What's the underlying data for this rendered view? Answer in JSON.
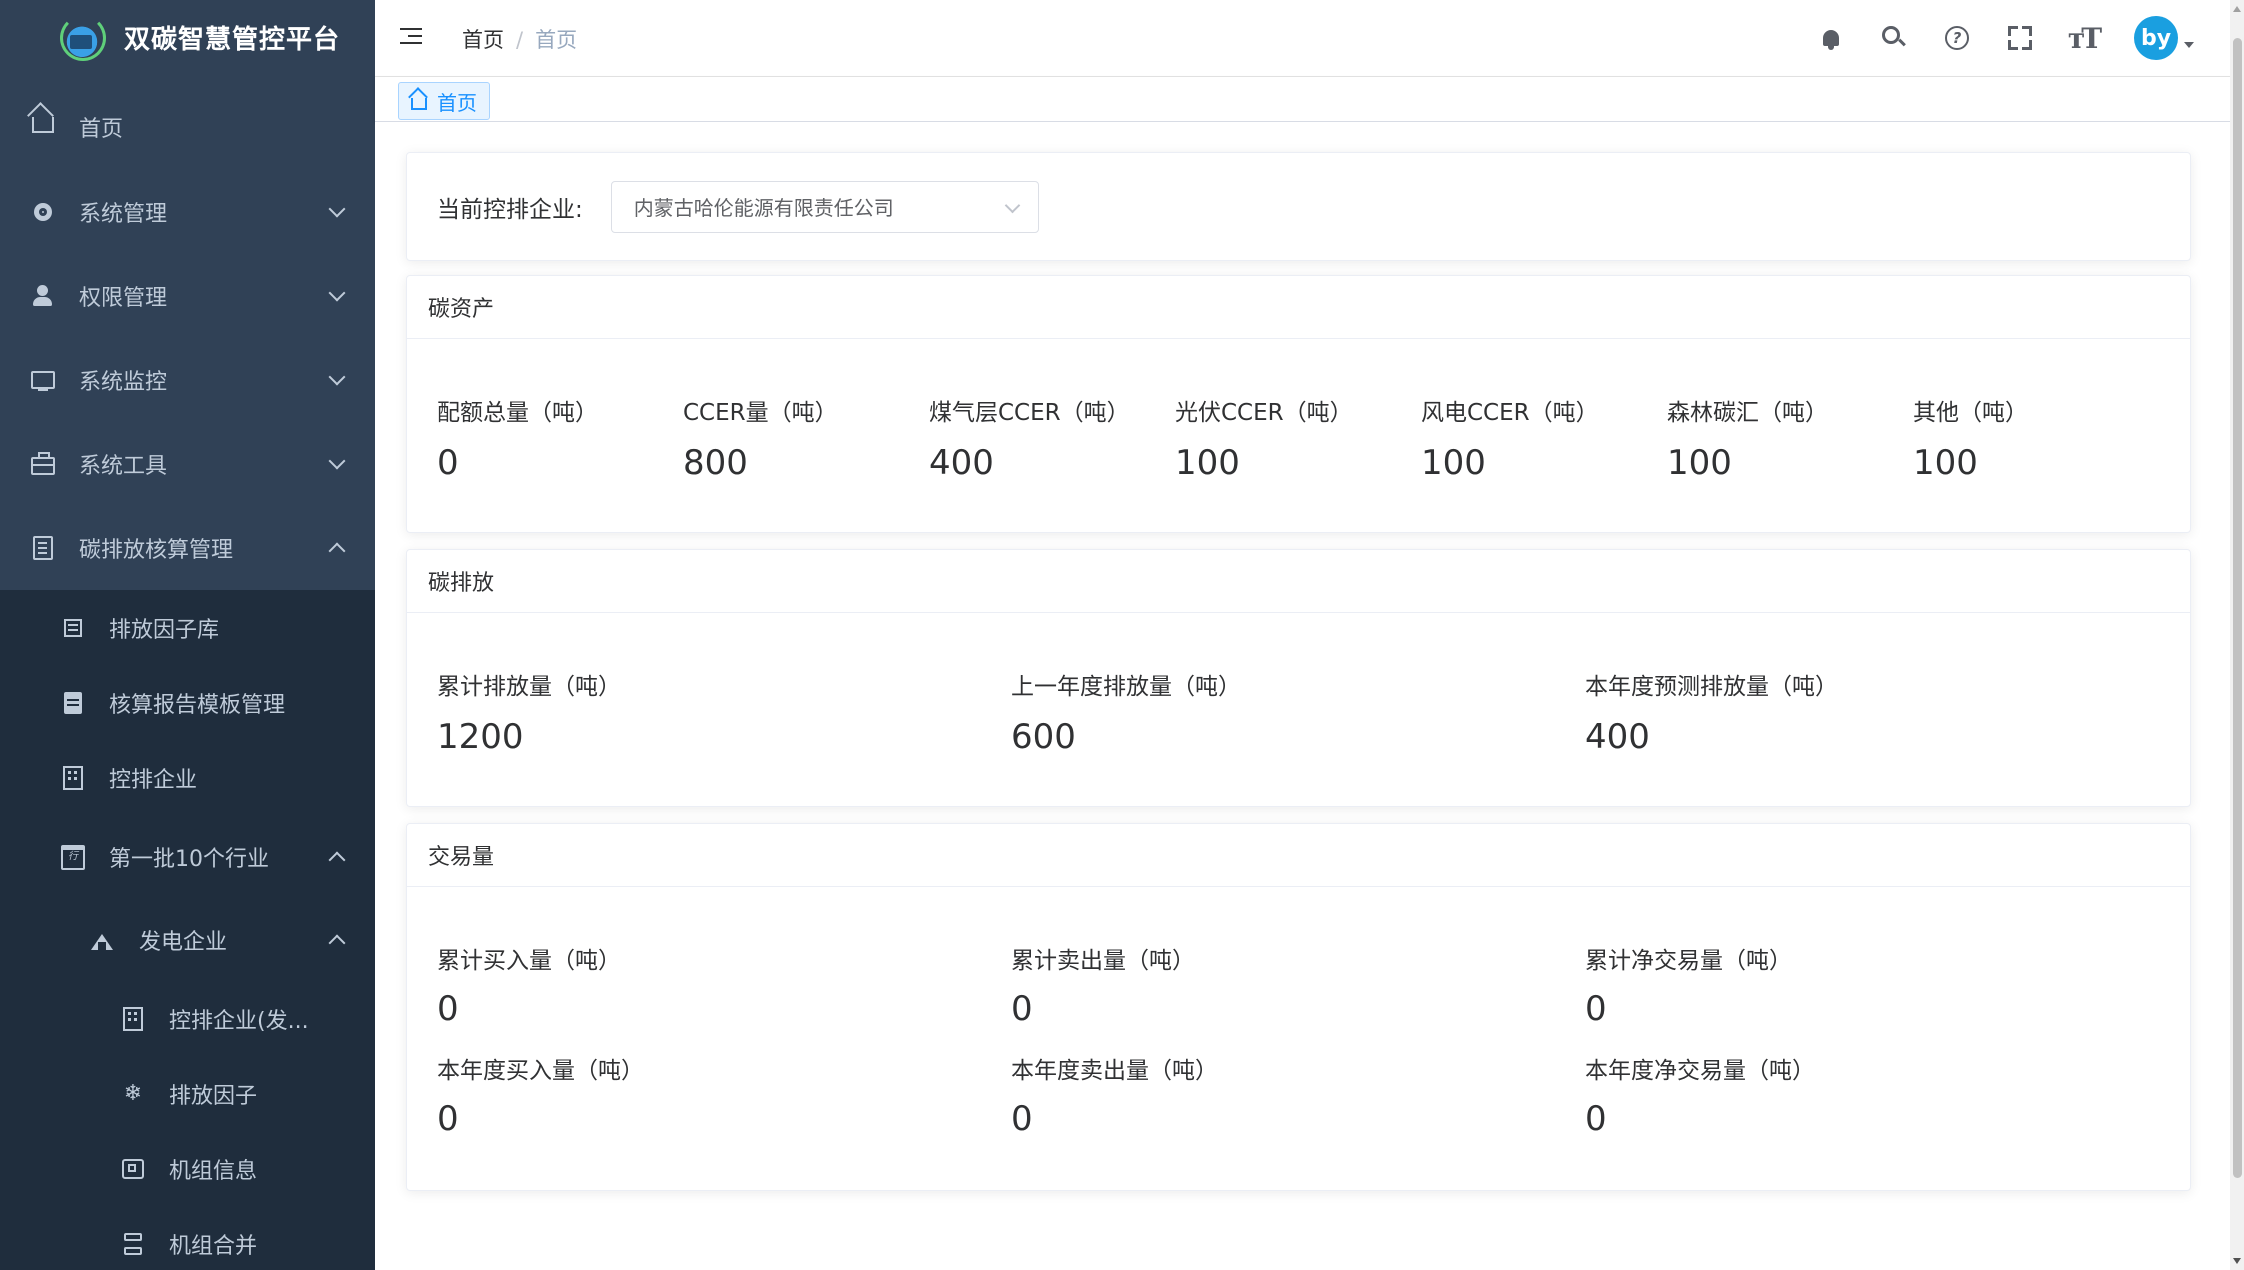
{
  "app": {
    "title": "双碳智慧管控平台"
  },
  "sidebar": {
    "items": [
      {
        "label": "首页",
        "icon": "home-icon"
      },
      {
        "label": "系统管理",
        "icon": "gear-icon"
      },
      {
        "label": "权限管理",
        "icon": "user-icon"
      },
      {
        "label": "系统监控",
        "icon": "monitor-icon"
      },
      {
        "label": "系统工具",
        "icon": "toolbox-icon"
      },
      {
        "label": "碳排放核算管理",
        "icon": "document-icon"
      }
    ],
    "subitems": [
      {
        "label": "排放因子库",
        "icon": "list-icon"
      },
      {
        "label": "核算报告模板管理",
        "icon": "file-icon"
      },
      {
        "label": "控排企业",
        "icon": "building-icon"
      },
      {
        "label": "第一批10个行业",
        "icon": "calendar-icon",
        "icon_text": "行"
      },
      {
        "label": "发电企业",
        "icon": "factory-icon"
      },
      {
        "label": "控排企业(发...",
        "icon": "building-icon"
      },
      {
        "label": "排放因子",
        "icon": "snowflake-icon",
        "icon_text": "❄"
      },
      {
        "label": "机组信息",
        "icon": "chip-icon"
      },
      {
        "label": "机组合并",
        "icon": "database-icon"
      }
    ]
  },
  "header": {
    "breadcrumb": [
      "首页",
      "首页"
    ],
    "separator": "/",
    "avatar_text": "by",
    "textsize_glyph": "тT",
    "help_glyph": "?"
  },
  "tags": {
    "active": "首页"
  },
  "company": {
    "label": "当前控排企业:",
    "selected": "内蒙古哈伦能源有限责任公司"
  },
  "carbon_assets": {
    "title": "碳资产",
    "items": [
      {
        "label": "配额总量（吨）",
        "value": "0"
      },
      {
        "label": "CCER量（吨）",
        "value": "800"
      },
      {
        "label": "煤气层CCER（吨）",
        "value": "400"
      },
      {
        "label": "光伏CCER（吨）",
        "value": "100"
      },
      {
        "label": "风电CCER（吨）",
        "value": "100"
      },
      {
        "label": "森林碳汇（吨）",
        "value": "100"
      },
      {
        "label": "其他（吨）",
        "value": "100"
      }
    ]
  },
  "carbon_emissions": {
    "title": "碳排放",
    "items": [
      {
        "label": "累计排放量（吨）",
        "value": "1200"
      },
      {
        "label": "上一年度排放量（吨）",
        "value": "600"
      },
      {
        "label": "本年度预测排放量（吨）",
        "value": "400"
      }
    ]
  },
  "trading": {
    "title": "交易量",
    "items": [
      {
        "label": "累计买入量（吨）",
        "value": "0"
      },
      {
        "label": "累计卖出量（吨）",
        "value": "0"
      },
      {
        "label": "累计净交易量（吨）",
        "value": "0"
      },
      {
        "label": "本年度买入量（吨）",
        "value": "0"
      },
      {
        "label": "本年度卖出量（吨）",
        "value": "0"
      },
      {
        "label": "本年度净交易量（吨）",
        "value": "0"
      }
    ]
  }
}
